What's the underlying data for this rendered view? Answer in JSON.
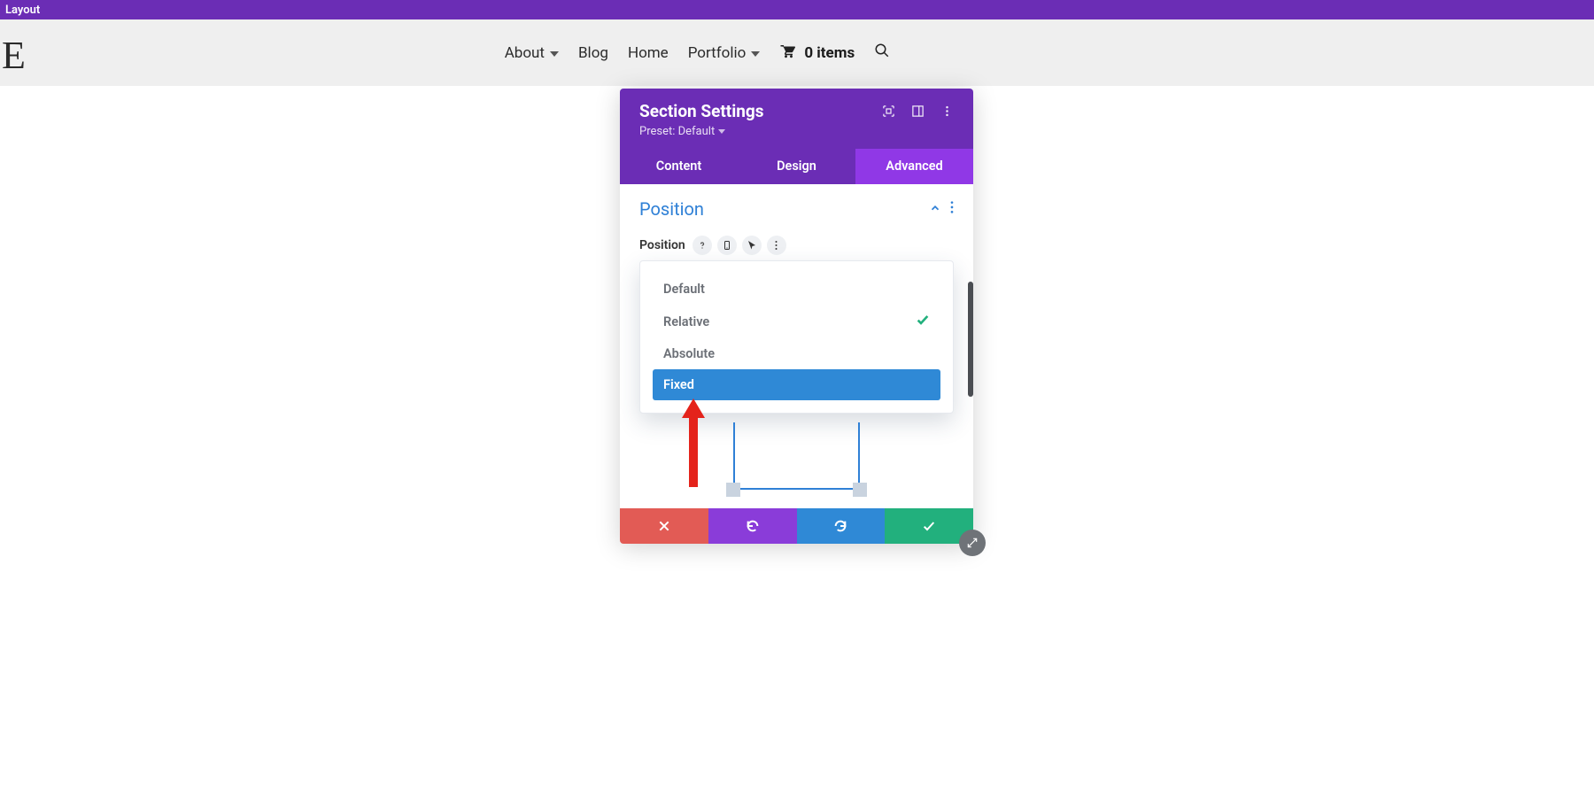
{
  "topbar": {
    "label": "Layout"
  },
  "nav": {
    "items": [
      {
        "label": "About",
        "has_submenu": true
      },
      {
        "label": "Blog",
        "has_submenu": false
      },
      {
        "label": "Home",
        "has_submenu": false
      },
      {
        "label": "Portfolio",
        "has_submenu": true
      }
    ],
    "cart_count": "0 items"
  },
  "panel": {
    "title": "Section Settings",
    "preset_label": "Preset: Default",
    "tabs": [
      "Content",
      "Design",
      "Advanced"
    ],
    "active_tab": 2,
    "section": {
      "title": "Position"
    },
    "field": {
      "label": "Position"
    },
    "options": [
      "Default",
      "Relative",
      "Absolute",
      "Fixed"
    ],
    "selected_index": 1,
    "highlight_index": 3
  }
}
